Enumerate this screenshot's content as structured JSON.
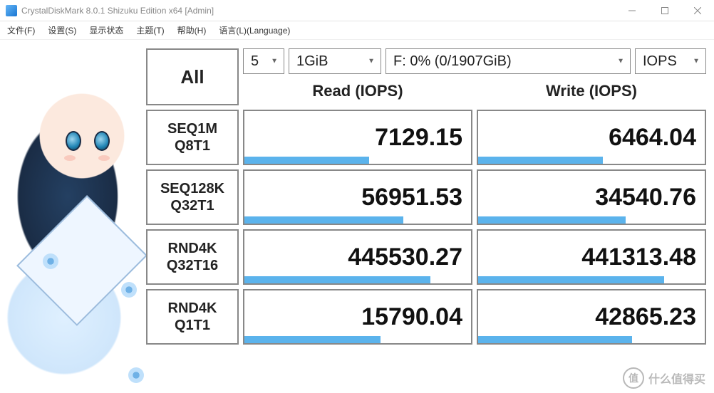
{
  "window": {
    "title": "CrystalDiskMark 8.0.1 Shizuku Edition x64 [Admin]"
  },
  "menu": {
    "file": "文件(F)",
    "settings": "设置(S)",
    "display": "显示状态",
    "theme": "主题(T)",
    "help": "帮助(H)",
    "language": "语言(L)(Language)"
  },
  "controls": {
    "all_label": "All",
    "count": "5",
    "size": "1GiB",
    "drive": "F: 0% (0/1907GiB)",
    "mode": "IOPS"
  },
  "headers": {
    "read": "Read (IOPS)",
    "write": "Write (IOPS)"
  },
  "tests": [
    {
      "line1": "SEQ1M",
      "line2": "Q8T1",
      "read": "7129.15",
      "read_pct": 55,
      "write": "6464.04",
      "write_pct": 55
    },
    {
      "line1": "SEQ128K",
      "line2": "Q32T1",
      "read": "56951.53",
      "read_pct": 70,
      "write": "34540.76",
      "write_pct": 65
    },
    {
      "line1": "RND4K",
      "line2": "Q32T16",
      "read": "445530.27",
      "read_pct": 82,
      "write": "441313.48",
      "write_pct": 82
    },
    {
      "line1": "RND4K",
      "line2": "Q1T1",
      "read": "15790.04",
      "read_pct": 60,
      "write": "42865.23",
      "write_pct": 68
    }
  ],
  "watermark": {
    "badge": "值",
    "text": "什么值得买"
  }
}
